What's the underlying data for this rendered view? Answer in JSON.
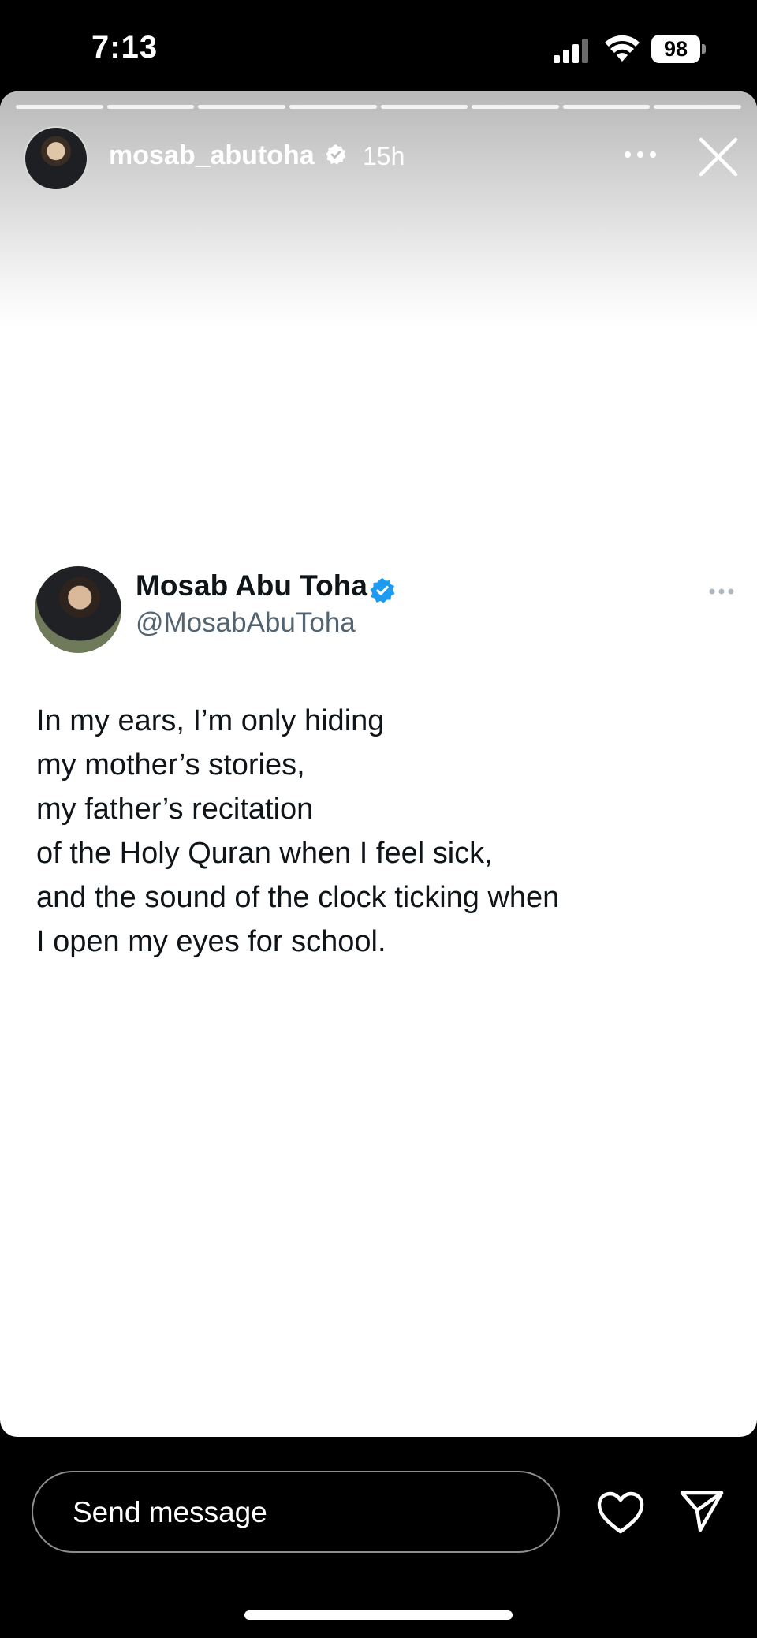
{
  "status_bar": {
    "time": "7:13",
    "battery": "98",
    "icons": [
      "signal-icon",
      "wifi-icon",
      "battery-icon"
    ]
  },
  "story": {
    "username": "mosab_abutoha",
    "age": "15h",
    "segments": 8,
    "icons": [
      "verified-icon",
      "more-icon",
      "close-icon"
    ]
  },
  "tweet": {
    "name": "Mosab Abu Toha",
    "handle": "@MosabAbuToha",
    "lines": [
      "In my ears, I’m only hiding",
      "my mother’s stories,",
      "my father’s recitation",
      "of the Holy Quran when I feel sick,",
      "and the sound of the clock ticking when",
      "I open my eyes for school."
    ],
    "icons": [
      "verified-badge-icon",
      "more-icon"
    ],
    "colors": {
      "name": "#0f1419",
      "handle": "#536471",
      "verified": "#1d9bf0"
    }
  },
  "footer": {
    "message_placeholder": "Send message",
    "icons": [
      "heart-icon",
      "send-icon"
    ]
  }
}
